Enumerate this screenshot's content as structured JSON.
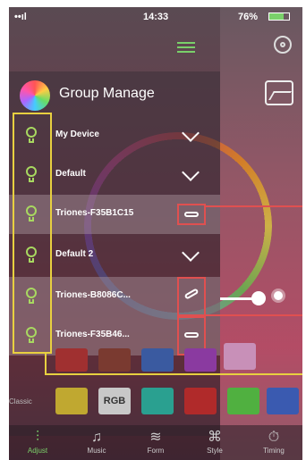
{
  "status": {
    "signal": "••ıl",
    "time": "14:33",
    "battery": "76%"
  },
  "header": {
    "title": "Group Manage"
  },
  "groups": [
    {
      "name": "My Device"
    },
    {
      "name": "Default"
    },
    {
      "name": "Default 2"
    }
  ],
  "devices": [
    {
      "name": "Triones-F35B1C15"
    },
    {
      "name": "Triones-B8086C..."
    },
    {
      "name": "Triones-F35B46..."
    }
  ],
  "colors": {
    "accent_green": "#7ad06a",
    "highlight_yellow": "#e8d040",
    "highlight_red": "#e05050"
  },
  "classic": {
    "label": "Classic",
    "rgb_label": "RGB"
  },
  "tabs": [
    {
      "label": "Adjust",
      "icon": "sliders-icon"
    },
    {
      "label": "Music",
      "icon": "music-note-icon"
    },
    {
      "label": "Form",
      "icon": "wave-icon"
    },
    {
      "label": "Style",
      "icon": "command-icon"
    },
    {
      "label": "Timing",
      "icon": "timer-icon"
    }
  ]
}
